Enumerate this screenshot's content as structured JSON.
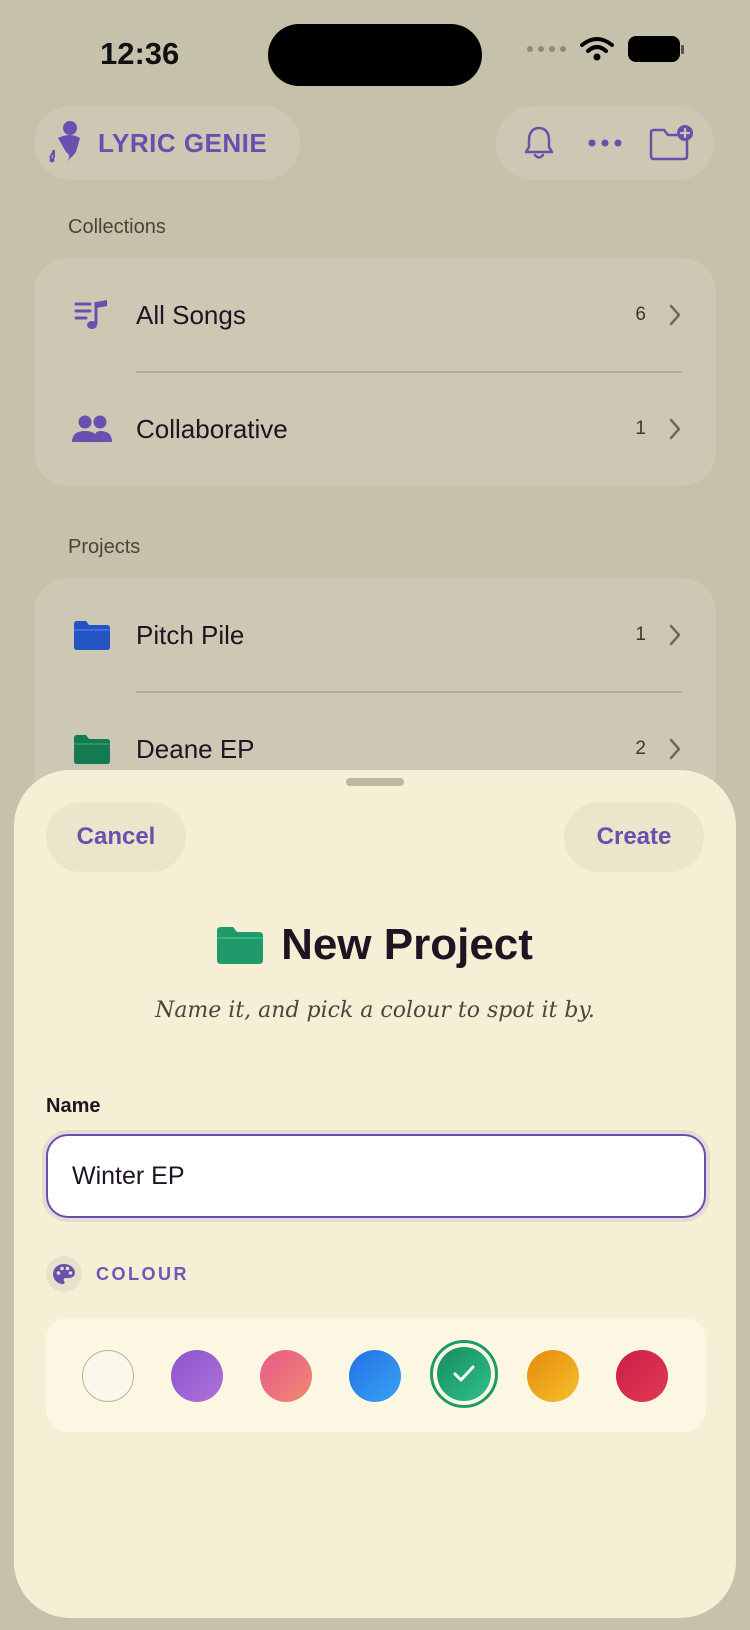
{
  "status_bar": {
    "time": "12:36"
  },
  "header": {
    "logo_text": "LYRIC GENIE",
    "bell_icon": "bell-icon",
    "more_icon": "ellipsis-icon",
    "new_folder_icon": "folder-plus-icon"
  },
  "collections": {
    "label": "Collections",
    "items": [
      {
        "label": "All Songs",
        "count": "6",
        "icon": "music-list-icon"
      },
      {
        "label": "Collaborative",
        "count": "1",
        "icon": "people-icon"
      }
    ]
  },
  "projects": {
    "label": "Projects",
    "items": [
      {
        "label": "Pitch Pile",
        "count": "1",
        "icon": "folder-icon",
        "color": "#2454c4"
      },
      {
        "label": "Deane EP",
        "count": "2",
        "icon": "folder-icon",
        "color": "#137a52"
      }
    ]
  },
  "sheet": {
    "cancel_label": "Cancel",
    "create_label": "Create",
    "title": "New Project",
    "subtitle": "Name it, and pick a colour to spot it by.",
    "name_label": "Name",
    "name_value": "Winter EP",
    "colour_label": "COLOUR",
    "title_icon_color": "#1f9a6a",
    "swatches": [
      {
        "name": "none",
        "color": "#fbf7ea"
      },
      {
        "name": "purple",
        "color": "#9560cf"
      },
      {
        "name": "pink",
        "color": "#ec6b7d"
      },
      {
        "name": "blue",
        "color": "#2b84ee"
      },
      {
        "name": "green",
        "color": "#1f9a6a",
        "selected": true
      },
      {
        "name": "orange",
        "color": "#eea21a"
      },
      {
        "name": "red",
        "color": "#d92a4c"
      }
    ]
  },
  "colors": {
    "accent": "#6b4fae",
    "background": "#c6c1ab",
    "sheet": "#f5efd6"
  }
}
